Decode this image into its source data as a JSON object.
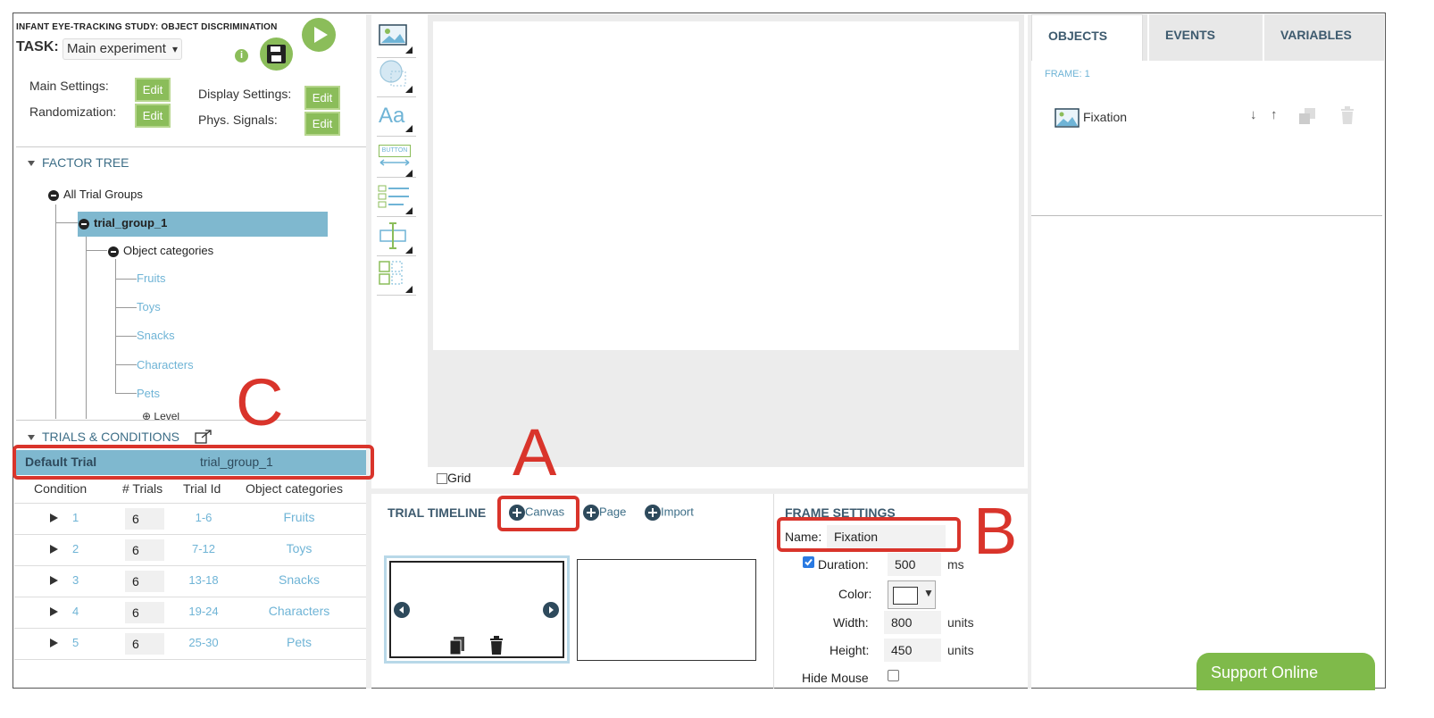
{
  "header": {
    "study_title": "INFANT EYE-TRACKING STUDY: OBJECT DISCRIMINATION",
    "task_label": "TASK:",
    "task_value": "Main experiment",
    "info_glyph": "i",
    "settings": {
      "main": "Main Settings:",
      "randomization": "Randomization:",
      "display": "Display Settings:",
      "phys": "Phys. Signals:",
      "edit": "Edit"
    }
  },
  "factor_tree": {
    "title": "FACTOR TREE",
    "root": "All Trial Groups",
    "group": "trial_group_1",
    "factor": "Object categories",
    "levels": [
      "Fruits",
      "Toys",
      "Snacks",
      "Characters",
      "Pets"
    ],
    "partial_item": "Level"
  },
  "trials": {
    "title": "TRIALS & CONDITIONS",
    "default_label": "Default Trial",
    "default_group": "trial_group_1",
    "columns": [
      "Condition",
      "# Trials",
      "Trial Id",
      "Object categories"
    ],
    "rows": [
      {
        "condition": "1",
        "trials": "6",
        "trial_id": "1-6",
        "category": "Fruits"
      },
      {
        "condition": "2",
        "trials": "6",
        "trial_id": "7-12",
        "category": "Toys"
      },
      {
        "condition": "3",
        "trials": "6",
        "trial_id": "13-18",
        "category": "Snacks"
      },
      {
        "condition": "4",
        "trials": "6",
        "trial_id": "19-24",
        "category": "Characters"
      },
      {
        "condition": "5",
        "trials": "6",
        "trial_id": "25-30",
        "category": "Pets"
      }
    ]
  },
  "toolbar": {
    "icons": [
      "image-tool-icon",
      "shape-tool-icon",
      "text-tool-icon",
      "button-tool-icon",
      "list-tool-icon",
      "input-tool-icon",
      "layout-tool-icon"
    ],
    "text_glyph": "Aa",
    "button_glyph": "BUTTON"
  },
  "canvas": {
    "grid_label": "Grid"
  },
  "timeline": {
    "title": "TRIAL TIMELINE",
    "canvas": "Canvas",
    "page": "Page",
    "import": "Import"
  },
  "frame_settings": {
    "title": "FRAME SETTINGS",
    "name_label": "Name:",
    "name_value": "Fixation",
    "duration_label": "Duration:",
    "duration_value": "500",
    "duration_unit": "ms",
    "color_label": "Color:",
    "width_label": "Width:",
    "width_value": "800",
    "height_label": "Height:",
    "height_value": "450",
    "units": "units",
    "hide_mouse_label": "Hide Mouse"
  },
  "right_panel": {
    "tabs": [
      "OBJECTS",
      "EVENTS",
      "VARIABLES"
    ],
    "frame_label": "FRAME: 1",
    "object_name": "Fixation"
  },
  "annotations": {
    "a": "A",
    "b": "B",
    "c": "C"
  },
  "support": "Support Online"
}
